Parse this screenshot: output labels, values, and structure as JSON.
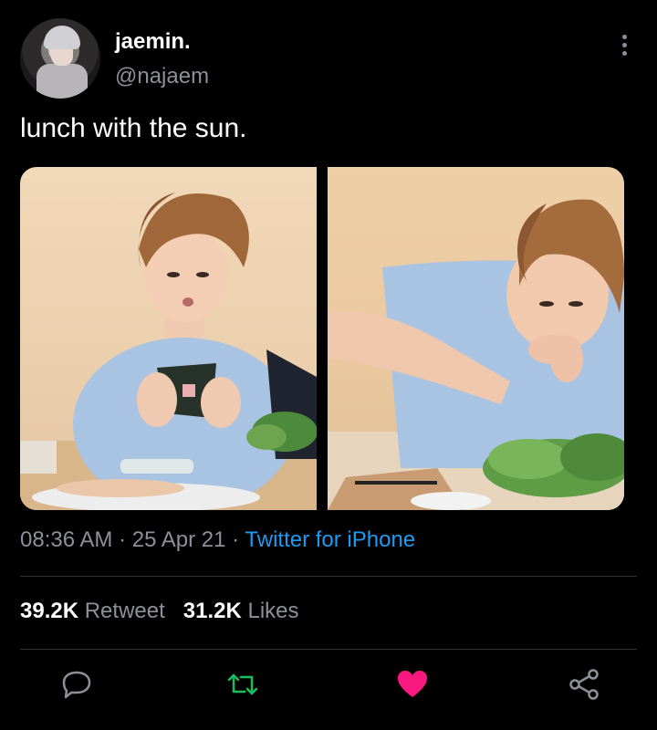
{
  "tweet": {
    "author": {
      "name": "jaemin.",
      "handle": "@najaem"
    },
    "text": "lunch with the sun.",
    "time": "08:36 AM",
    "date": "25 Apr 21",
    "separator": "·",
    "source": "Twitter for iPhone"
  },
  "stats": {
    "retweets": "39.2K",
    "retweet_label": "Retweet",
    "likes": "31.2K",
    "likes_label": "Likes"
  },
  "actions": [
    {
      "name": "reply",
      "icon": "reply-icon"
    },
    {
      "name": "retweet",
      "icon": "retweet-icon",
      "color": "#17bf63"
    },
    {
      "name": "like",
      "icon": "heart-icon",
      "color": "#f91880"
    },
    {
      "name": "share",
      "icon": "share-icon"
    }
  ],
  "colors": {
    "background": "#000000",
    "text": "#ffffff",
    "muted": "#8b9196",
    "link": "#1d9bf0",
    "retweet_green": "#17bf63",
    "like_pink": "#f91880"
  }
}
